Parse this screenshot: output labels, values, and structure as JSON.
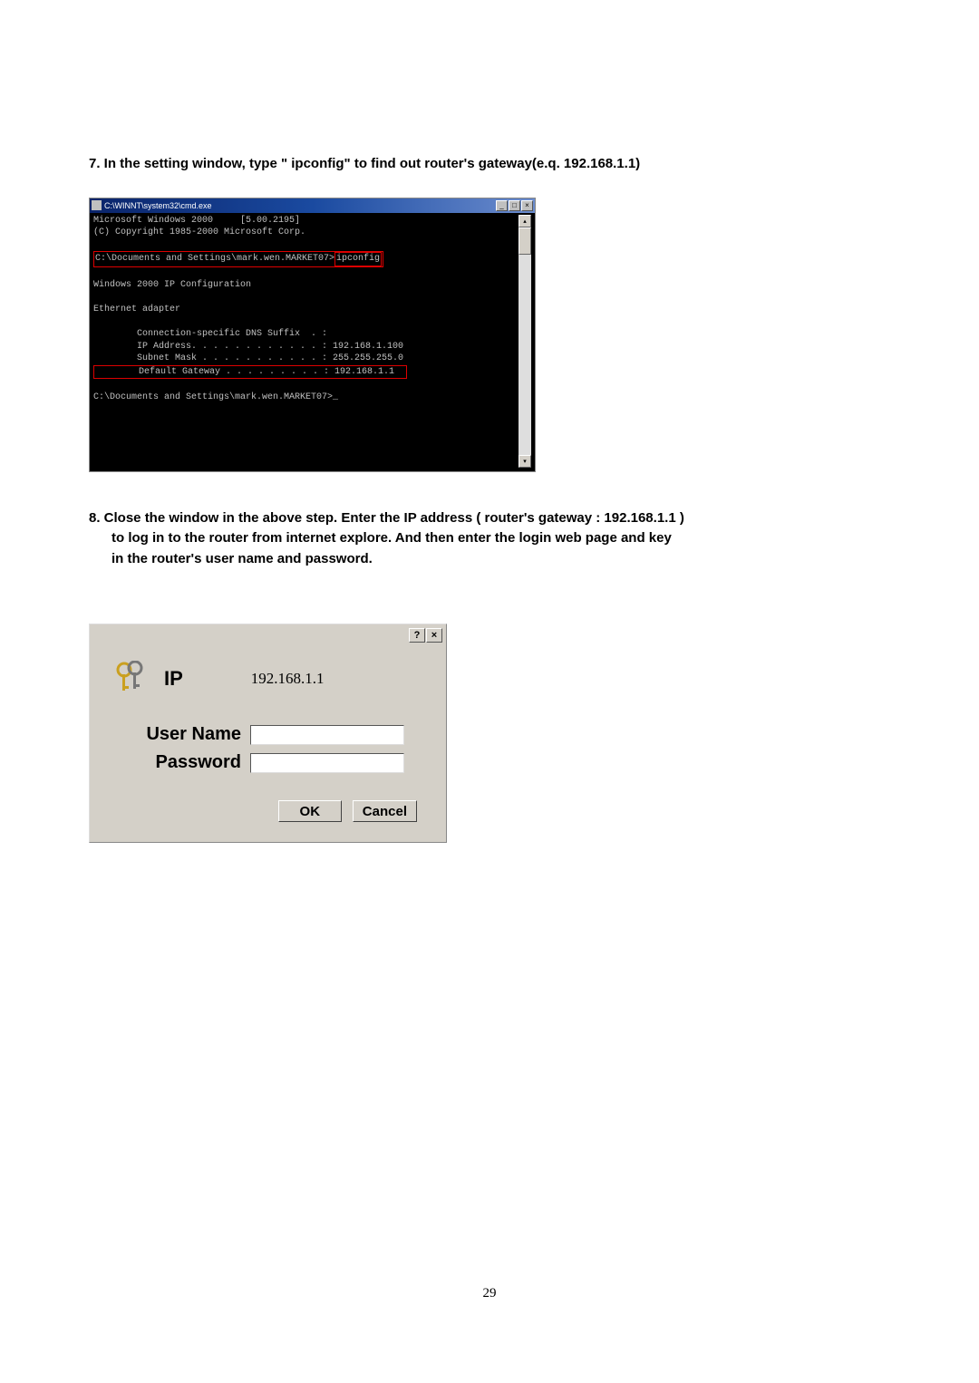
{
  "step7": {
    "text": "7. In the setting window, type \" ipconfig\" to  find out router's gateway(e.q. 192.168.1.1)"
  },
  "cmd": {
    "title": "C:\\WINNT\\system32\\cmd.exe",
    "min": "_",
    "max": "□",
    "close": "×",
    "scroll_up": "▴",
    "scroll_down": "▾",
    "line1a": "Microsoft Windows 2000     [5.00.2195]",
    "line1b": "(C) Copyright 1985-2000 Microsoft Corp.",
    "prompt1a": "C:\\Documents and Settings\\mark.wen.MARKET07>",
    "prompt1b": "ipconfig",
    "line3": "Windows 2000 IP Configuration",
    "line4": "Ethernet adapter",
    "line5": "        Connection-specific DNS Suffix  . :",
    "line6": "        IP Address. . . . . . . . . . . . : 192.168.1.100",
    "line7": "        Subnet Mask . . . . . . . . . . . : 255.255.255.0",
    "line8": "        Default Gateway . . . . . . . . . : 192.168.1.1  ",
    "prompt2": "C:\\Documents and Settings\\mark.wen.MARKET07>_"
  },
  "step8": {
    "line1": "8. Close the window  in the above step. Enter the IP address ( router's gateway : 192.168.1.1 )",
    "line2": "to log in to the router from internet explore. And then enter the login web page and key",
    "line3": "in the router's user name and password."
  },
  "login": {
    "help": "?",
    "close": "×",
    "ip_label": "IP",
    "ip_value": "192.168.1.1",
    "username_label": "User Name",
    "password_label": "Password",
    "ok": "OK",
    "cancel": "Cancel"
  },
  "page_number": "29"
}
